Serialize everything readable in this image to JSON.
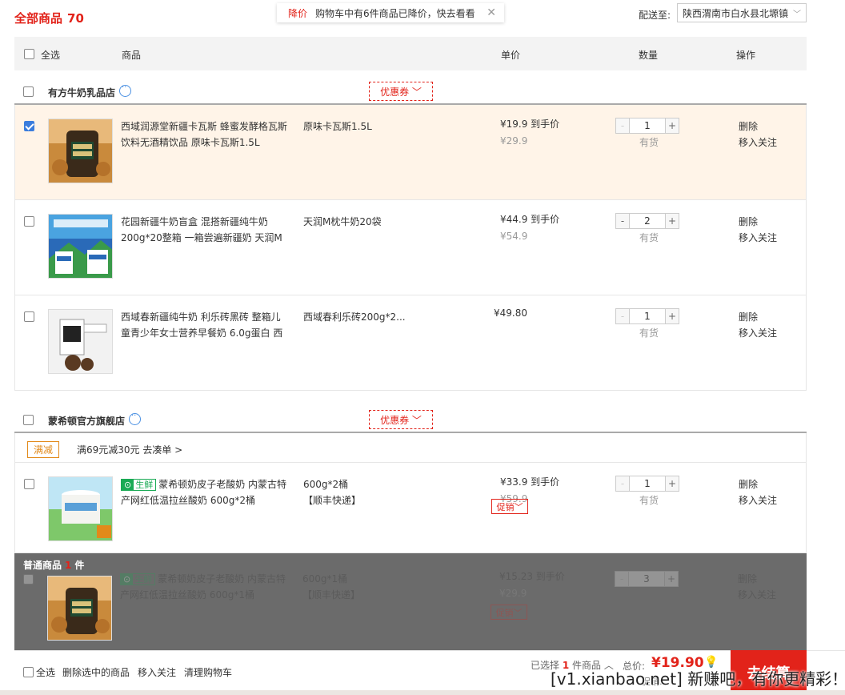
{
  "header": {
    "title": "全部商品",
    "count": "70",
    "notice_tag": "降价",
    "notice_msg": "购物车中有6件商品已降价，快去看看",
    "close_glyph": "✕",
    "ship_label": "配送至:",
    "ship_address": "陕西渭南市白水县北塬镇"
  },
  "columns": {
    "select_all": "全选",
    "product": "商品",
    "unit_price": "单价",
    "quantity": "数量",
    "action": "操作"
  },
  "shops": [
    {
      "name": "有方牛奶乳品店",
      "coupon": "优惠券"
    },
    {
      "name": "蒙希顿官方旗舰店",
      "coupon": "优惠券"
    }
  ],
  "products": [
    {
      "checked": true,
      "name": "西域润源堂新疆卡瓦斯 蜂蜜发酵格瓦斯饮料无酒精饮品 原味卡瓦斯1.5L",
      "spec": "原味卡瓦斯1.5L",
      "price": "¥19.9 到手价",
      "orig_price": "¥29.9",
      "qty": "1",
      "stock": "有货",
      "delete": "删除",
      "follow": "移入关注"
    },
    {
      "checked": false,
      "name": "花园新疆牛奶盲盒 混搭新疆纯牛奶200g*20整箱 一箱尝遍新疆奶 天润M",
      "spec": "天润M枕牛奶20袋",
      "price": "¥44.9 到手价",
      "orig_price": "¥54.9",
      "qty": "2",
      "stock": "有货",
      "delete": "删除",
      "follow": "移入关注"
    },
    {
      "checked": false,
      "name": "西域春新疆纯牛奶 利乐砖黑砖 整箱儿童青少年女士营养早餐奶 6.0g蛋白 西",
      "spec": "西域春利乐砖200g*2...",
      "price": "¥49.80",
      "orig_price": "",
      "qty": "1",
      "stock": "有货",
      "delete": "删除",
      "follow": "移入关注"
    },
    {
      "checked": false,
      "fresh_label": "生鲜",
      "name": "蒙希顿奶皮子老酸奶 内蒙古特产网红低温拉丝酸奶 600g*2桶",
      "spec": "600g*2桶",
      "spec2": "【顺丰快递】",
      "price": "¥33.9 到手价",
      "orig_price": "¥59.9",
      "promo": "促销",
      "qty": "1",
      "stock": "有货",
      "delete": "删除",
      "follow": "移入关注"
    }
  ],
  "full_reduction": {
    "tag": "满减",
    "text": "满69元减30元  去凑单 >"
  },
  "overlay": {
    "label": "普通商品",
    "count": "1",
    "unit": "件",
    "item": {
      "fresh_label": "生鲜",
      "name": "蒙希顿奶皮子老酸奶 内蒙古特产网红低温拉丝酸奶 600g*1桶",
      "spec": "600g*1桶",
      "spec2": "【顺丰快递】",
      "price": "¥15.23 到手价",
      "orig_price": "¥29.9",
      "promo": "促销",
      "qty": "3",
      "delete": "删除",
      "follow": "移入关注"
    }
  },
  "footer": {
    "select_all": "全选",
    "delete_selected": "删除选中的商品",
    "move_follow": "移入关注",
    "clear_cart": "清理购物车",
    "selected_prefix": "已选择",
    "selected_count": "1",
    "selected_suffix": "件商品",
    "total_label": "总价:",
    "total": "¥19.90",
    "discount": "促销:",
    "checkout": "去结算"
  },
  "watermark": "[v1.xianbao.net] 新赚吧，有你更精彩！",
  "colors": {
    "accent": "#e2231a",
    "selected_row": "#fff4e8",
    "fresh": "#1aaa55"
  }
}
